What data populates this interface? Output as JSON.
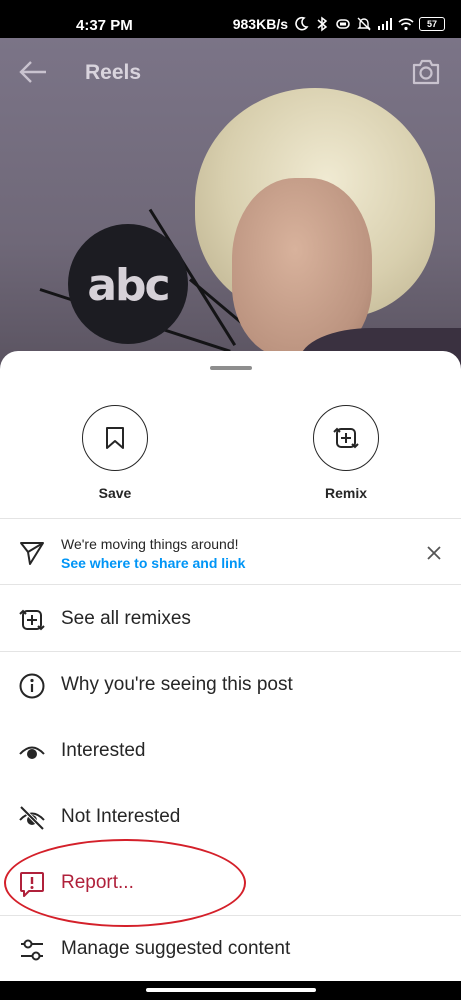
{
  "status_bar": {
    "time": "4:37 PM",
    "speed": "983KB/s",
    "battery": "57"
  },
  "header": {
    "title": "Reels",
    "back_icon": "back-arrow-icon",
    "camera_icon": "camera-icon"
  },
  "video": {
    "logo_text": "abc"
  },
  "actions": [
    {
      "label": "Save",
      "icon": "bookmark-icon"
    },
    {
      "label": "Remix",
      "icon": "remix-icon"
    }
  ],
  "notice": {
    "title": "We're moving things around!",
    "link": "See where to share and link",
    "icon": "send-icon",
    "close_icon": "close-icon"
  },
  "menu": [
    {
      "label": "See all remixes",
      "icon": "remix-icon"
    },
    {
      "label": "Why you're seeing this post",
      "icon": "info-icon"
    },
    {
      "label": "Interested",
      "icon": "eye-icon"
    },
    {
      "label": "Not Interested",
      "icon": "eye-off-icon"
    },
    {
      "label": "Report...",
      "icon": "report-icon",
      "color": "#b0213b"
    },
    {
      "label": "Manage suggested content",
      "icon": "sliders-icon"
    }
  ],
  "colors": {
    "link": "#0095f6",
    "danger": "#b0213b",
    "annotation": "#d4202a"
  }
}
